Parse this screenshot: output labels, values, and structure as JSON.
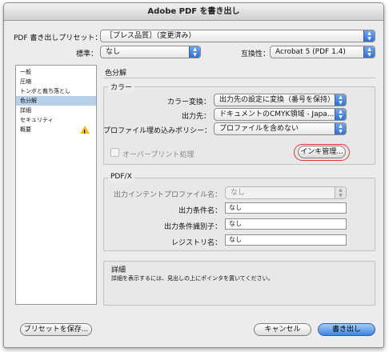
{
  "window": {
    "title": "Adobe PDF を書き出し"
  },
  "preset": {
    "label": "PDF 書き出しプリセット：",
    "value": "［プレス品質］（変更済み）"
  },
  "standard": {
    "label": "標準：",
    "value": "なし"
  },
  "compatibility": {
    "label": "互換性：",
    "value": "Acrobat 5 (PDF 1.4)"
  },
  "sidebar": {
    "items": [
      {
        "label": "一般"
      },
      {
        "label": "圧縮"
      },
      {
        "label": "トンボと裁ち落とし"
      },
      {
        "label": "色分解"
      },
      {
        "label": "詳細"
      },
      {
        "label": "セキュリティ"
      },
      {
        "label": "概要"
      }
    ]
  },
  "panel": {
    "heading": "色分解"
  },
  "color_group": {
    "title": "カラー",
    "conversion": {
      "label": "カラー変換：",
      "value": "出力先の設定に変換（番号を保持）"
    },
    "destination": {
      "label": "出力先：",
      "value": "ドキュメントのCMYK領域 - Japa..."
    },
    "profile_policy": {
      "label": "プロファイル埋め込みポリシー：",
      "value": "プロファイルを含めない"
    },
    "overprint_label": "オーバープリント処理",
    "ink_manager_label": "インキ管理..."
  },
  "pdfx_group": {
    "title": "PDF/X",
    "output_intent": {
      "label": "出力インテントプロファイル名：",
      "value": "なし"
    },
    "output_condition": {
      "label": "出力条件名：",
      "value": "なし"
    },
    "output_condition_id": {
      "label": "出力条件識別子：",
      "value": "なし"
    },
    "registry": {
      "label": "レジストリ名：",
      "value": "なし"
    }
  },
  "details_group": {
    "title": "詳細",
    "text": "詳細を表示するには、見出しの上にポインタを置いてください。"
  },
  "footer": {
    "save_preset": "プリセットを保存...",
    "cancel": "キャンセル",
    "export": "書き出し"
  },
  "colors": {
    "accent": "#3a86df",
    "selection": "#b8cfea",
    "highlight": "#e0392f",
    "warning": "#f3c01a"
  },
  "icons": {
    "warning": "warning-icon",
    "popup_arrows": "popup-arrows-icon"
  }
}
